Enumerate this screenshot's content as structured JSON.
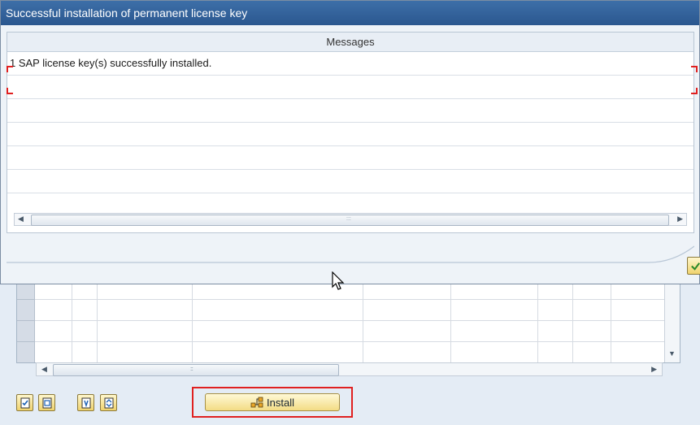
{
  "dialog": {
    "title": "Successful installation of permanent license key",
    "messages_header": "Messages",
    "messages": [
      "1 SAP license key(s) successfully installed."
    ]
  },
  "footer": {
    "ok_icon": "checkmark-icon"
  },
  "toolbar": {
    "install_label": "Install",
    "install_icon": "network-structure-icon",
    "buttons": [
      "select-all-icon",
      "deselect-all-icon",
      "details-icon",
      "sort-icon"
    ]
  },
  "colors": {
    "titlebar": "#2b578f",
    "highlight": "#e02020",
    "button": "#f0d36e"
  }
}
